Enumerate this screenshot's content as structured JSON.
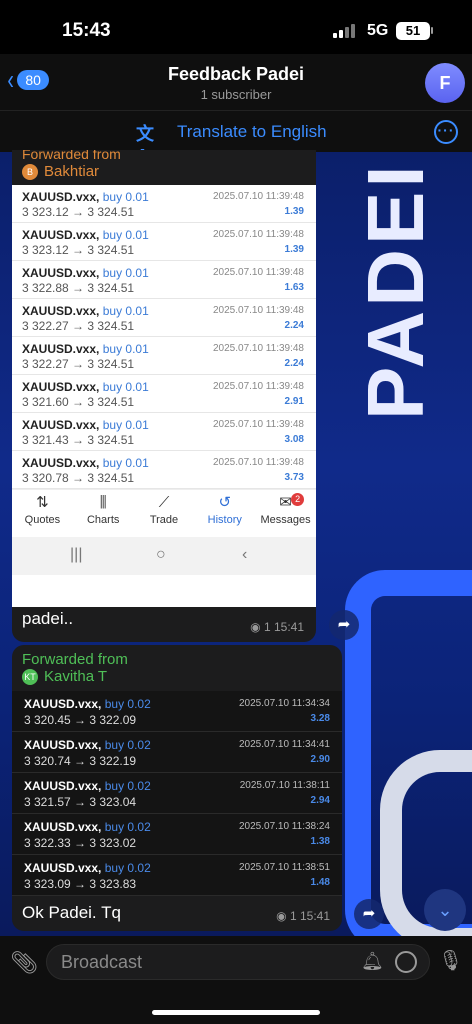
{
  "status": {
    "time": "15:43",
    "network": "5G",
    "battery": "51"
  },
  "header": {
    "back_count": "80",
    "title": "Feedback Padei",
    "subtitle": "1 subscriber",
    "avatar_letter": "F"
  },
  "translate": {
    "label": "Translate to English"
  },
  "wallpaper": {
    "text": "PADEI"
  },
  "message1": {
    "forwarded_label": "Forwarded from",
    "forwarded_name": "Bakhtiar",
    "forwarded_initial": "B",
    "trades": [
      {
        "symbol": "XAUUSD.vxx,",
        "side": "buy 0.01",
        "prices": "3 323.12 → 3 324.51",
        "datetime": "2025.07.10 11:39:48",
        "profit": "1.39"
      },
      {
        "symbol": "XAUUSD.vxx,",
        "side": "buy 0.01",
        "prices": "3 323.12 → 3 324.51",
        "datetime": "2025.07.10 11:39:48",
        "profit": "1.39"
      },
      {
        "symbol": "XAUUSD.vxx,",
        "side": "buy 0.01",
        "prices": "3 322.88 → 3 324.51",
        "datetime": "2025.07.10 11:39:48",
        "profit": "1.63"
      },
      {
        "symbol": "XAUUSD.vxx,",
        "side": "buy 0.01",
        "prices": "3 322.27 → 3 324.51",
        "datetime": "2025.07.10 11:39:48",
        "profit": "2.24"
      },
      {
        "symbol": "XAUUSD.vxx,",
        "side": "buy 0.01",
        "prices": "3 322.27 → 3 324.51",
        "datetime": "2025.07.10 11:39:48",
        "profit": "2.24"
      },
      {
        "symbol": "XAUUSD.vxx,",
        "side": "buy 0.01",
        "prices": "3 321.60 → 3 324.51",
        "datetime": "2025.07.10 11:39:48",
        "profit": "2.91"
      },
      {
        "symbol": "XAUUSD.vxx,",
        "side": "buy 0.01",
        "prices": "3 321.43 → 3 324.51",
        "datetime": "2025.07.10 11:39:48",
        "profit": "3.08"
      },
      {
        "symbol": "XAUUSD.vxx,",
        "side": "buy 0.01",
        "prices": "3 320.78 → 3 324.51",
        "datetime": "2025.07.10 11:39:48",
        "profit": "3.73"
      }
    ],
    "tabs": [
      {
        "label": "Quotes",
        "icon": "⇅"
      },
      {
        "label": "Charts",
        "icon": "⫼"
      },
      {
        "label": "Trade",
        "icon": "⟋"
      },
      {
        "label": "History",
        "icon": "↺"
      },
      {
        "label": "Messages",
        "icon": "✉",
        "badge": "2"
      }
    ],
    "text": "Coleect dlu..lama btol sidai..tq padei..",
    "views": "1",
    "time": "15:41"
  },
  "message2": {
    "forwarded_label": "Forwarded from",
    "forwarded_name": "Kavitha T",
    "forwarded_initial": "KT",
    "trades": [
      {
        "symbol": "XAUUSD.vxx,",
        "side": "buy 0.02",
        "prices": "3 320.45 → 3 322.09",
        "datetime": "2025.07.10 11:34:34",
        "profit": "3.28"
      },
      {
        "symbol": "XAUUSD.vxx,",
        "side": "buy 0.02",
        "prices": "3 320.74 → 3 322.19",
        "datetime": "2025.07.10 11:34:41",
        "profit": "2.90"
      },
      {
        "symbol": "XAUUSD.vxx,",
        "side": "buy 0.02",
        "prices": "3 321.57 → 3 323.04",
        "datetime": "2025.07.10 11:38:11",
        "profit": "2.94"
      },
      {
        "symbol": "XAUUSD.vxx,",
        "side": "buy 0.02",
        "prices": "3 322.33 → 3 323.02",
        "datetime": "2025.07.10 11:38:24",
        "profit": "1.38"
      },
      {
        "symbol": "XAUUSD.vxx,",
        "side": "buy 0.02",
        "prices": "3 323.09 → 3 323.83",
        "datetime": "2025.07.10 11:38:51",
        "profit": "1.48"
      }
    ],
    "text": "Ok Padei. Tq",
    "views": "1",
    "time": "15:41"
  },
  "input": {
    "placeholder": "Broadcast"
  }
}
